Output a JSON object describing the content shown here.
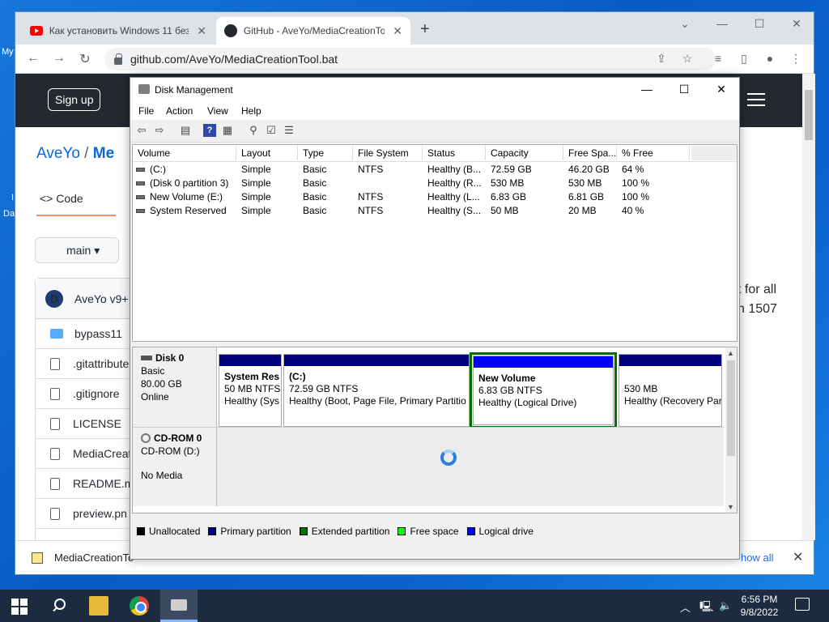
{
  "desktop": {
    "labels": [
      "My",
      "I",
      "Da"
    ]
  },
  "browser": {
    "tabs": [
      {
        "title": "Как установить Windows 11 без",
        "icon": "youtube-icon"
      },
      {
        "title": "GitHub - AveYo/MediaCreationTo",
        "icon": "github-icon"
      }
    ],
    "new_tab": "+",
    "address": "github.com/AveYo/MediaCreationTool.bat",
    "window_controls": {
      "minimize": "—",
      "maximize": "☐",
      "close": "✕",
      "dropdown": "⌄"
    }
  },
  "github": {
    "sign_up": "Sign up",
    "owner": "AveYo",
    "separator": " / ",
    "repo_prefix": "Me",
    "code_tab": "Code",
    "branch": "main",
    "commit_author": "AveYo v9+",
    "avatar_letter": "D",
    "files": [
      {
        "name": "bypass11",
        "type": "folder"
      },
      {
        "name": ".gitattribute",
        "type": "file"
      },
      {
        "name": ".gitignore",
        "type": "file"
      },
      {
        "name": "LICENSE",
        "type": "file"
      },
      {
        "name": "MediaCreat",
        "type": "file"
      },
      {
        "name": "README.m",
        "type": "file"
      },
      {
        "name": "preview.pn",
        "type": "file"
      }
    ],
    "readme_fragments": [
      "t for all",
      "n 1507"
    ],
    "download_name": "MediaCreationTo",
    "show_all": "how all"
  },
  "disk_mgmt": {
    "title": "Disk Management",
    "menu": [
      "File",
      "Action",
      "View",
      "Help"
    ],
    "columns": [
      "Volume",
      "Layout",
      "Type",
      "File System",
      "Status",
      "Capacity",
      "Free Spa...",
      "% Free"
    ],
    "volumes": [
      {
        "volume": "(C:)",
        "layout": "Simple",
        "type": "Basic",
        "fs": "NTFS",
        "status": "Healthy (B...",
        "capacity": "72.59 GB",
        "free": "46.20 GB",
        "pct": "64 %"
      },
      {
        "volume": "(Disk 0 partition 3)",
        "layout": "Simple",
        "type": "Basic",
        "fs": "",
        "status": "Healthy (R...",
        "capacity": "530 MB",
        "free": "530 MB",
        "pct": "100 %"
      },
      {
        "volume": "New Volume (E:)",
        "layout": "Simple",
        "type": "Basic",
        "fs": "NTFS",
        "status": "Healthy (L...",
        "capacity": "6.83 GB",
        "free": "6.81 GB",
        "pct": "100 %"
      },
      {
        "volume": "System Reserved",
        "layout": "Simple",
        "type": "Basic",
        "fs": "NTFS",
        "status": "Healthy (S...",
        "capacity": "50 MB",
        "free": "20 MB",
        "pct": "40 %"
      }
    ],
    "disk0": {
      "name": "Disk 0",
      "type": "Basic",
      "size": "80.00 GB",
      "status": "Online",
      "partitions": [
        {
          "name": "System Res",
          "line1": "50 MB NTFS",
          "line2": "Healthy (Sys"
        },
        {
          "name": "(C:)",
          "line1": "72.59 GB NTFS",
          "line2": "Healthy (Boot, Page File, Primary Partitio"
        },
        {
          "name": "New Volume",
          "line1": "6.83 GB NTFS",
          "line2": "Healthy (Logical Drive)"
        },
        {
          "name": "",
          "line1": "530 MB",
          "line2": "Healthy (Recovery Par"
        }
      ]
    },
    "cdrom": {
      "name": "CD-ROM 0",
      "drive": "CD-ROM (D:)",
      "media": "No Media"
    },
    "legend": [
      {
        "label": "Unallocated",
        "color": "#000000"
      },
      {
        "label": "Primary partition",
        "color": "#000080"
      },
      {
        "label": "Extended partition",
        "color": "#007000"
      },
      {
        "label": "Free space",
        "color": "#00ff00"
      },
      {
        "label": "Logical drive",
        "color": "#0000ff"
      }
    ]
  },
  "taskbar": {
    "time": "6:56 PM",
    "date": "9/8/2022"
  }
}
